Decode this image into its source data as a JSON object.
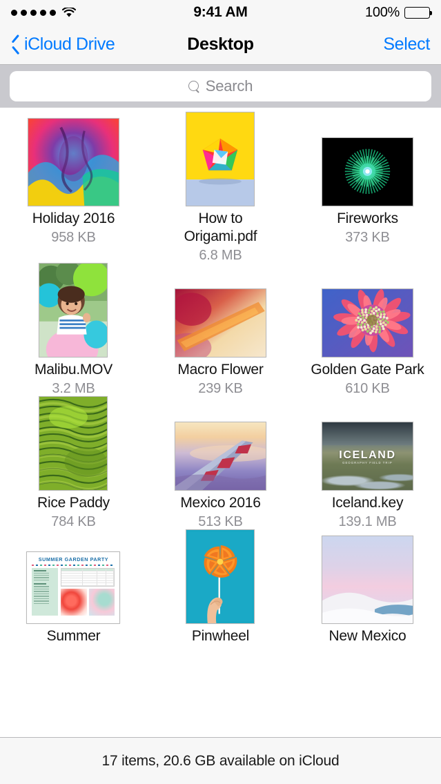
{
  "status_bar": {
    "signal_dots": 5,
    "wifi_icon": "wifi-icon",
    "time": "9:41 AM",
    "battery_percent": "100%",
    "battery_icon": "battery-full-icon"
  },
  "nav_bar": {
    "back_icon": "chevron-left-icon",
    "back_label": "iCloud Drive",
    "title": "Desktop",
    "select_label": "Select"
  },
  "search": {
    "icon": "search-icon",
    "placeholder": "Search",
    "value": ""
  },
  "files": [
    {
      "name": "Holiday 2016",
      "size": "958 KB",
      "art": "holiday",
      "shape": "square"
    },
    {
      "name": "How to Origami.pdf",
      "size": "6.8 MB",
      "art": "origami",
      "shape": "portrait"
    },
    {
      "name": "Fireworks",
      "size": "373 KB",
      "art": "fireworks",
      "shape": "landscape"
    },
    {
      "name": "Malibu.MOV",
      "size": "3.2 MB",
      "art": "malibu",
      "shape": "portrait"
    },
    {
      "name": "Macro Flower",
      "size": "239 KB",
      "art": "macro",
      "shape": "landscape"
    },
    {
      "name": "Golden Gate Park",
      "size": "610 KB",
      "art": "ggpark",
      "shape": "landscape"
    },
    {
      "name": "Rice Paddy",
      "size": "784 KB",
      "art": "ricepaddy",
      "shape": "portrait"
    },
    {
      "name": "Mexico 2016",
      "size": "513 KB",
      "art": "mexico",
      "shape": "landscape"
    },
    {
      "name": "Iceland.key",
      "size": "139.1 MB",
      "art": "iceland",
      "shape": "landscape"
    },
    {
      "name": "Summer",
      "size": "",
      "art": "summer",
      "shape": "document"
    },
    {
      "name": "Pinwheel",
      "size": "",
      "art": "pinwheel",
      "shape": "portrait"
    },
    {
      "name": "New Mexico",
      "size": "",
      "art": "newmexico",
      "shape": "square"
    }
  ],
  "toolbar": {
    "status_text": "17 items, 20.6 GB available on iCloud"
  },
  "colors": {
    "accent": "#007aff",
    "bar_background": "#f7f7f7",
    "search_background": "#c9c9ce",
    "filename": "#141414",
    "filesize": "#8e8e93"
  }
}
